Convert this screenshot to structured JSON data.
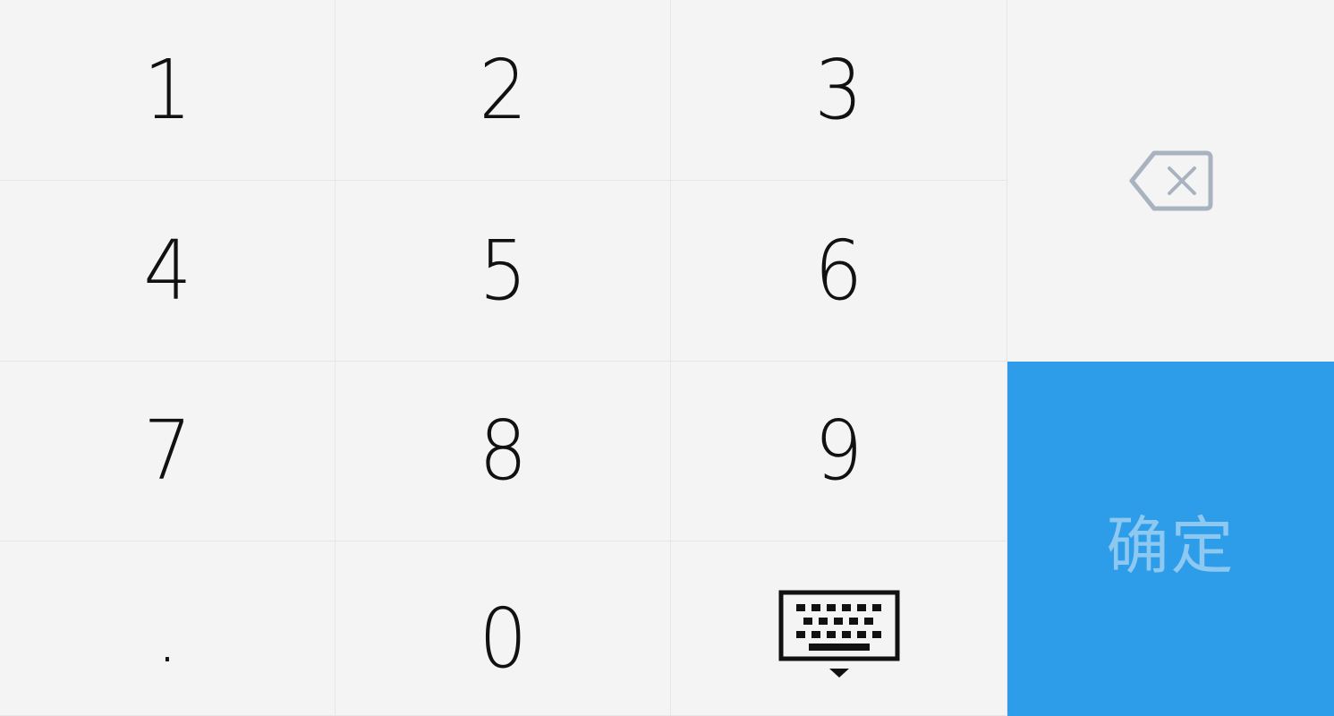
{
  "keypad": {
    "keys": {
      "one": "1",
      "two": "2",
      "three": "3",
      "four": "4",
      "five": "5",
      "six": "6",
      "seven": "7",
      "eight": "8",
      "nine": "9",
      "dot": ".",
      "zero": "0"
    },
    "hide_keyboard_icon": "keyboard-hide-icon",
    "backspace_icon": "backspace-icon",
    "confirm_label": "确定"
  },
  "colors": {
    "background": "#f4f4f4",
    "divider": "#e6e6e6",
    "digit_text": "#111111",
    "confirm_background": "#2d9ce9",
    "confirm_text": "#8cc8f0",
    "backspace_icon": "#a9b3bf"
  }
}
